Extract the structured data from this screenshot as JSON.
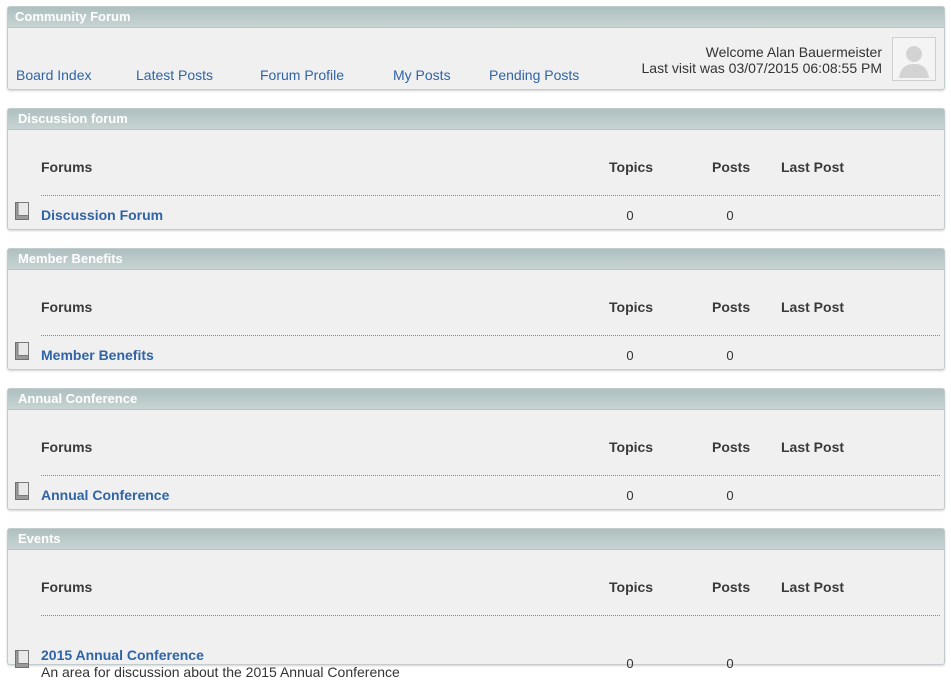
{
  "header": {
    "title": "Community Forum",
    "nav": [
      "Board Index",
      "Latest Posts",
      "Forum Profile",
      "My Posts",
      "Pending Posts"
    ],
    "welcome": "Welcome Alan Bauermeister",
    "last_visit": "Last visit was 03/07/2015 06:08:55 PM"
  },
  "columns": {
    "forums": "Forums",
    "topics": "Topics",
    "posts": "Posts",
    "last_post": "Last Post"
  },
  "sections": [
    {
      "title": "Discussion forum",
      "forum": {
        "name": "Discussion Forum",
        "topics": "0",
        "posts": "0"
      }
    },
    {
      "title": "Member Benefits",
      "forum": {
        "name": "Member Benefits",
        "topics": "0",
        "posts": "0"
      }
    },
    {
      "title": "Annual Conference",
      "forum": {
        "name": "Annual Conference",
        "topics": "0",
        "posts": "0"
      }
    },
    {
      "title": "Events",
      "forum": {
        "name": "2015 Annual Conference",
        "description": "An area for discussion about the 2015 Annual Conference",
        "topics": "0",
        "posts": "0"
      }
    }
  ],
  "colors": {
    "link": "#2f64a6",
    "header_bar": "#b8c8c8",
    "panel_bg": "#f0f0f0"
  }
}
